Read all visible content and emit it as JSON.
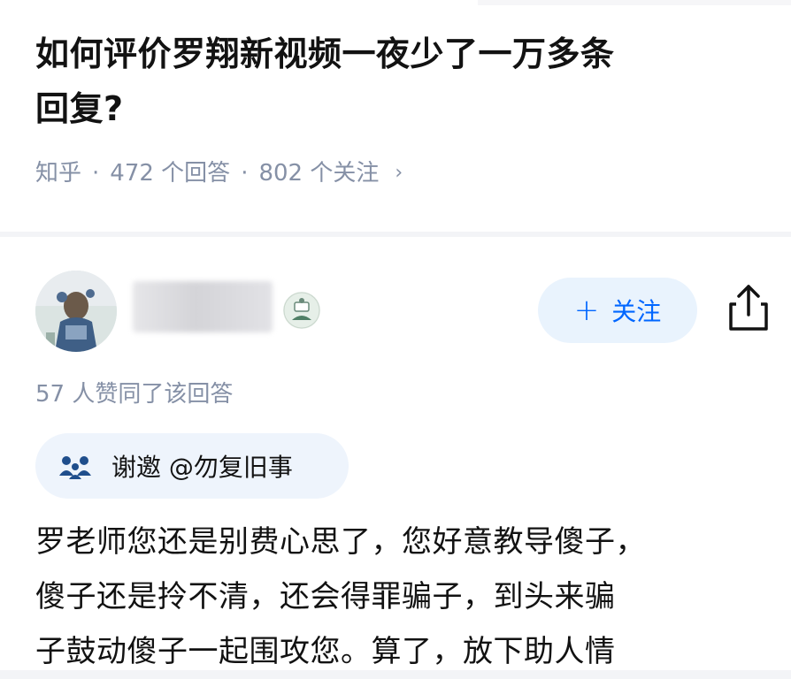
{
  "question": {
    "title_line1": "如何评价罗翔新视频一夜少了一万多条",
    "title_line2": "回复?",
    "source": "知乎",
    "answers_count": "472 个回答",
    "followers_count": "802 个关注",
    "separator": "·",
    "chevron": "›"
  },
  "answer": {
    "follow_plus": "+",
    "follow_label": "关注",
    "approval_text": "57 人赞同了该回答",
    "invite_text": "谢邀 @勿复旧事",
    "body_lines": [
      "罗老师您还是别费心思了，您好意教导傻子，",
      "傻子还是拎不清，还会得罪骗子，到头来骗",
      "子鼓动傻子一起围攻您。算了，放下助人情"
    ]
  },
  "colors": {
    "accent": "#0066ff",
    "meta": "#8590a6",
    "text": "#121212",
    "follow_bg": "#e9f3fd"
  },
  "icons": {
    "share": "share-icon",
    "invite": "people-icon",
    "chevron": "chevron-right-icon"
  }
}
